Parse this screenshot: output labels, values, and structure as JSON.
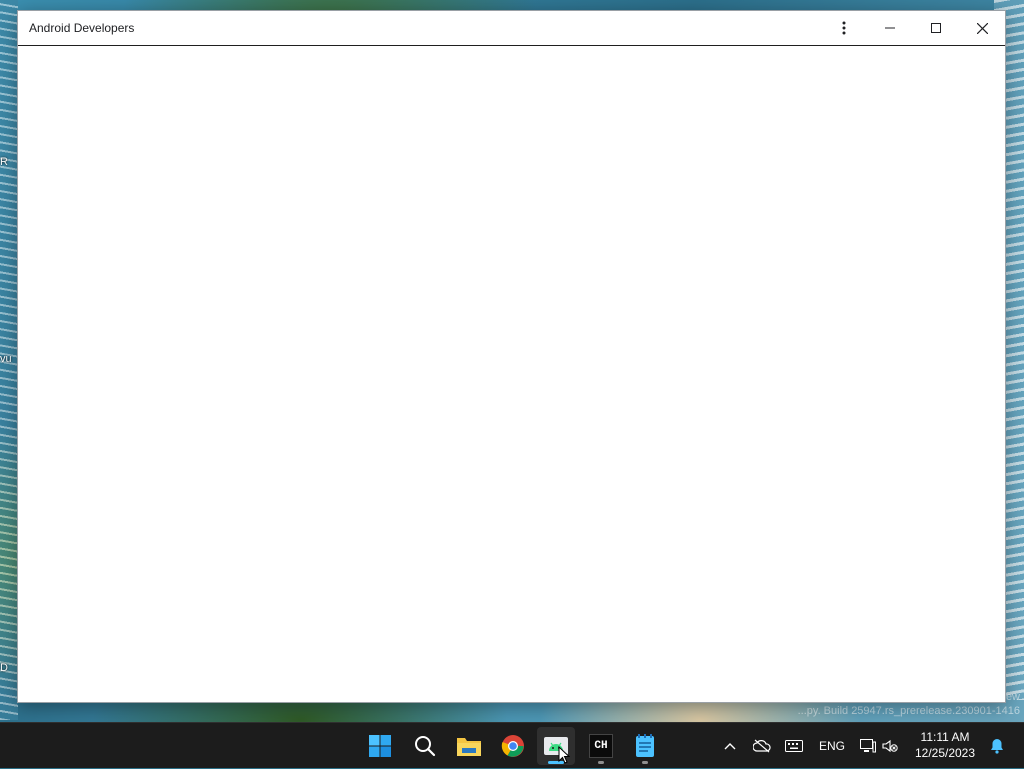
{
  "window": {
    "title": "Android Developers"
  },
  "desktop": {
    "icon_labels": [
      "R",
      "vu",
      "D"
    ],
    "watermark_line1": "ew",
    "watermark_line2": "...py. Build 25947.rs_prerelease.230901-1416"
  },
  "taskbar": {
    "apps": [
      {
        "name": "start",
        "icon": "windows-logo-icon"
      },
      {
        "name": "search",
        "icon": "search-icon"
      },
      {
        "name": "file-explorer",
        "icon": "folder-icon"
      },
      {
        "name": "chrome",
        "icon": "chrome-icon"
      },
      {
        "name": "android-studio",
        "icon": "android-icon",
        "active": true
      },
      {
        "name": "ch-app",
        "icon": "ch-icon",
        "label": "CH"
      },
      {
        "name": "notepad",
        "icon": "notepad-icon"
      }
    ],
    "tray": {
      "language": "ENG",
      "time": "11:11 AM",
      "date": "12/25/2023"
    }
  },
  "colors": {
    "taskbar_bg": "#1c1c1c",
    "active_indicator": "#4cc2ff",
    "window_bg": "#ffffff"
  }
}
